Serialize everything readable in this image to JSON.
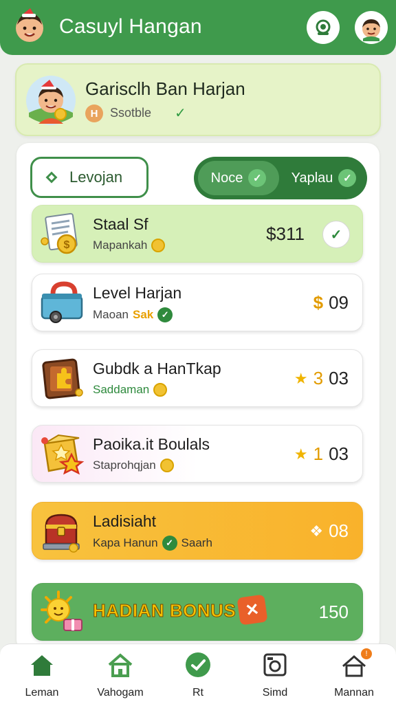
{
  "header": {
    "title": "Casuyl Hangan"
  },
  "profile": {
    "name": "Garisclh Ban Harjan",
    "status": "Ssotble"
  },
  "filters": {
    "level_button": "Levojan",
    "toggle_left": "Noce",
    "toggle_right": "Yaplau"
  },
  "rewards": [
    {
      "title": "Staal Sf",
      "subtitle": "Mapankah",
      "value": "$311"
    },
    {
      "title": "Level Harjan",
      "subtitle": "Maoan",
      "subtitle_highlight": "Sak",
      "value": "09",
      "value_prefix": "$"
    },
    {
      "title": "Gubdk a HanTkap",
      "subtitle": "Saddaman",
      "value": "03",
      "value_prefix": "3"
    },
    {
      "title": "Paoika.it Boulals",
      "subtitle": "Staprohqjan",
      "value": "03",
      "value_prefix": "1"
    },
    {
      "title": "Ladisiaht",
      "subtitle": "Kapa Hanun",
      "subtitle_extra": "Saarh",
      "value": "08"
    },
    {
      "title": "HADIAN BONUS",
      "value": "150"
    }
  ],
  "nav": {
    "items": [
      {
        "label": "Leman",
        "icon": "home-icon"
      },
      {
        "label": "Vahogam",
        "icon": "house-outline-icon"
      },
      {
        "label": "Rt",
        "icon": "check-circle-icon"
      },
      {
        "label": "Simd",
        "icon": "camera-icon"
      },
      {
        "label": "Mannan",
        "icon": "home-notification-icon",
        "badge": "!"
      }
    ]
  },
  "colors": {
    "primary_green": "#3f9a4c",
    "accent_orange": "#f9b22b",
    "coin_gold": "#f1c232"
  }
}
